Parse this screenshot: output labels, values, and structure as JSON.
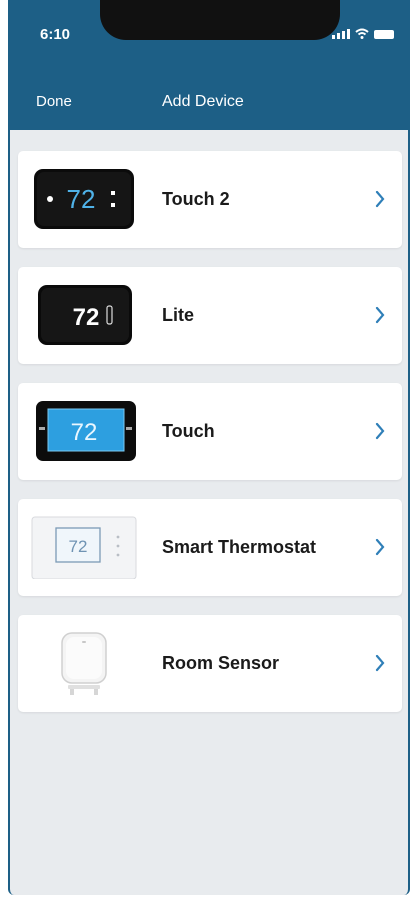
{
  "status_bar": {
    "time": "6:10"
  },
  "nav": {
    "done_label": "Done",
    "title": "Add Device"
  },
  "devices": [
    {
      "label": "Touch 2",
      "display": "72",
      "icon": "thermostat-touch2-icon"
    },
    {
      "label": "Lite",
      "display": "72",
      "icon": "thermostat-lite-icon"
    },
    {
      "label": "Touch",
      "display": "72",
      "icon": "thermostat-touch-icon"
    },
    {
      "label": "Smart Thermostat",
      "display": "72",
      "icon": "smart-thermostat-icon"
    },
    {
      "label": "Room Sensor",
      "icon": "room-sensor-icon"
    }
  ],
  "colors": {
    "header": "#1d5f86",
    "background": "#e8ebee",
    "chevron": "#2f7fb8"
  }
}
